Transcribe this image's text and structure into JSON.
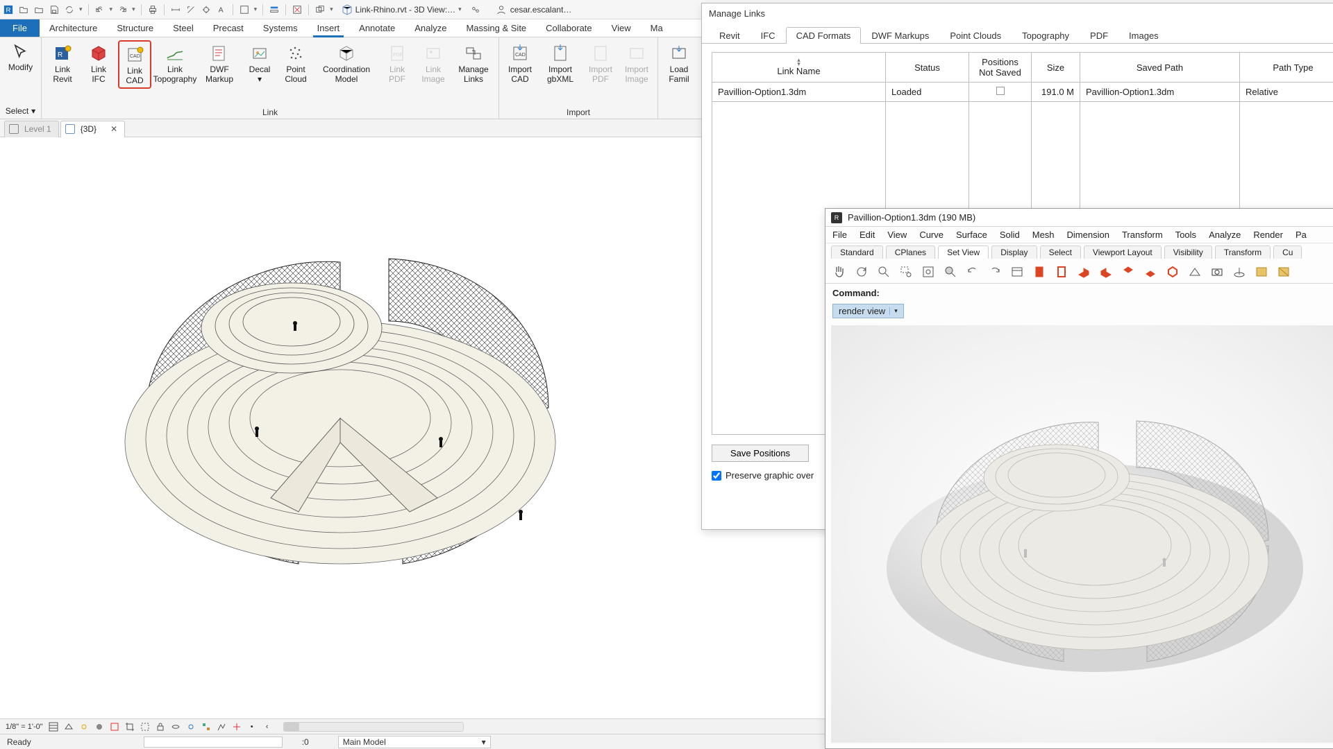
{
  "titlebar": {
    "document": "Link-Rhino.rvt - 3D View:…",
    "user": "cesar.escalant…",
    "icons": [
      "revit",
      "open",
      "save",
      "sync",
      "undo",
      "redo",
      "sep",
      "print",
      "measure",
      "align",
      "spot",
      "text",
      "sep",
      "cube"
    ]
  },
  "ribbon": {
    "file_label": "File",
    "tabs": [
      "Architecture",
      "Structure",
      "Steel",
      "Precast",
      "Systems",
      "Insert",
      "Annotate",
      "Analyze",
      "Massing & Site",
      "Collaborate",
      "View",
      "Ma"
    ],
    "active_tab": "Insert",
    "select_group": {
      "modify": "Modify",
      "select": "Select",
      "chev": "▾"
    },
    "link_group": {
      "label": "Link",
      "buttons": [
        {
          "name": "link-revit",
          "label": "Link\nRevit"
        },
        {
          "name": "link-ifc",
          "label": "Link\nIFC"
        },
        {
          "name": "link-cad",
          "label": "Link\nCAD",
          "highlight": true
        },
        {
          "name": "link-topography",
          "label": "Link\nTopography"
        },
        {
          "name": "dwf-markup",
          "label": "DWF\nMarkup"
        },
        {
          "name": "decal",
          "label": "Decal\n▾"
        },
        {
          "name": "point-cloud",
          "label": "Point\nCloud"
        },
        {
          "name": "coordination-model",
          "label": "Coordination\nModel"
        },
        {
          "name": "link-pdf",
          "label": "Link\nPDF",
          "dim": true
        },
        {
          "name": "link-image",
          "label": "Link\nImage",
          "dim": true
        },
        {
          "name": "manage-links",
          "label": "Manage\nLinks"
        }
      ]
    },
    "import_group": {
      "label": "Import",
      "buttons": [
        {
          "name": "import-cad",
          "label": "Import\nCAD"
        },
        {
          "name": "import-gbxml",
          "label": "Import\ngbXML"
        },
        {
          "name": "import-pdf",
          "label": "Import\nPDF",
          "dim": true
        },
        {
          "name": "import-image",
          "label": "Import\nImage",
          "dim": true
        }
      ]
    },
    "load_group": {
      "buttons": [
        {
          "name": "load-family",
          "label": "Load\nFamil"
        }
      ]
    }
  },
  "view_tabs": {
    "inactive": "Level 1",
    "active": "{3D}"
  },
  "statusbar": {
    "scale": "1/8\" = 1'-0\"",
    "icons_count": 16
  },
  "statusbar2": {
    "ready": "Ready",
    "zero": ":0",
    "workset": "Main Model"
  },
  "manage_links": {
    "title": "Manage Links",
    "tabs": [
      "Revit",
      "IFC",
      "CAD Formats",
      "DWF Markups",
      "Point Clouds",
      "Topography",
      "PDF",
      "Images"
    ],
    "active_tab": "CAD Formats",
    "columns": [
      "Link Name",
      "Status",
      "Positions\nNot Saved",
      "Size",
      "Saved Path",
      "Path Type"
    ],
    "row": {
      "name": "Pavillion-Option1.3dm",
      "status": "Loaded",
      "pos": "",
      "size": "191.0 M",
      "path": "Pavillion-Option1.3dm",
      "ptype": "Relative"
    },
    "save_positions": "Save Positions",
    "preserve": "Preserve graphic over"
  },
  "rhino": {
    "title": "Pavillion-Option1.3dm (190 MB)",
    "menu": [
      "File",
      "Edit",
      "View",
      "Curve",
      "Surface",
      "Solid",
      "Mesh",
      "Dimension",
      "Transform",
      "Tools",
      "Analyze",
      "Render",
      "Pa"
    ],
    "tool_tabs": [
      "Standard",
      "CPlanes",
      "Set View",
      "Display",
      "Select",
      "Viewport Layout",
      "Visibility",
      "Transform",
      "Cu"
    ],
    "active_tool_tab": "Set View",
    "command_label": "Command:",
    "command_chip": "render view"
  }
}
